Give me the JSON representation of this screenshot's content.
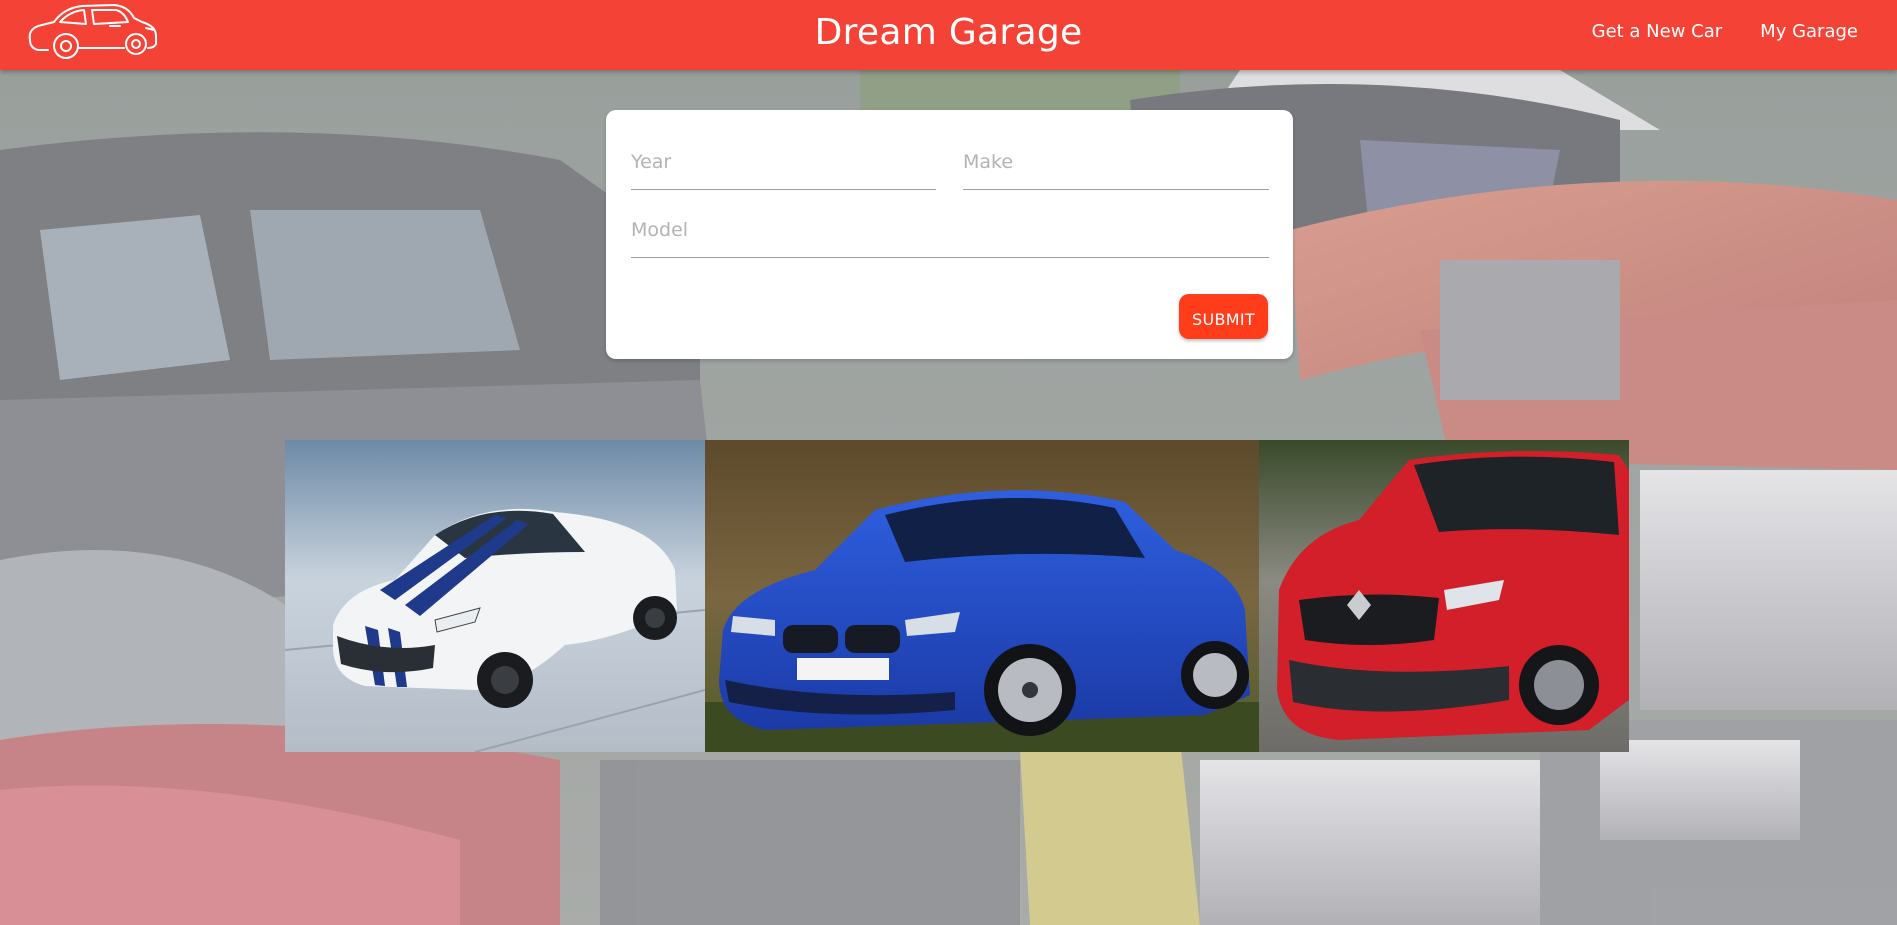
{
  "header": {
    "title": "Dream Garage",
    "logo_icon": "classic-car-outline-icon",
    "nav_links": [
      {
        "label": "Get a New Car"
      },
      {
        "label": "My Garage"
      }
    ]
  },
  "form": {
    "year_placeholder": "Year",
    "make_placeholder": "Make",
    "model_placeholder": "Model",
    "submit_label": "SUBMIT"
  },
  "gallery": [
    {
      "icon": "white-sports-coupe-photo"
    },
    {
      "icon": "blue-sedan-photo"
    },
    {
      "icon": "red-suv-photo"
    }
  ],
  "colors": {
    "navbar": "#f44336",
    "submit": "#ff3d1a",
    "card": "#ffffff"
  }
}
